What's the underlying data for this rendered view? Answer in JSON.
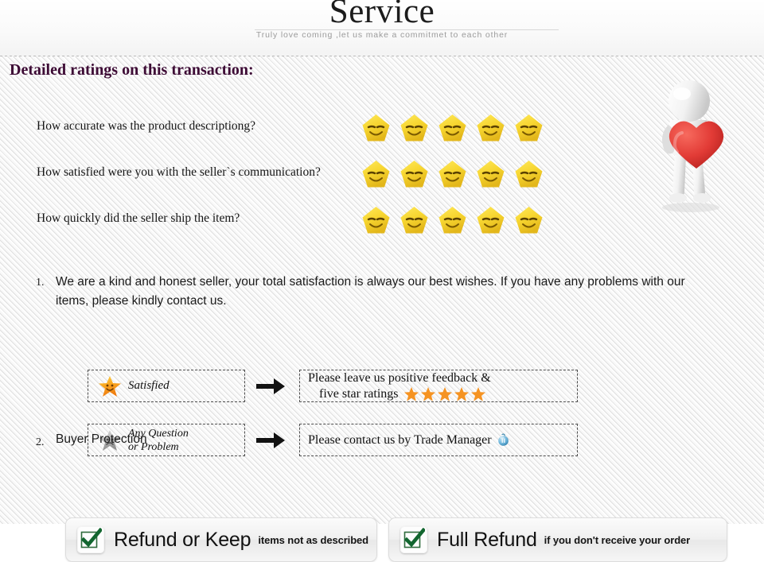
{
  "header": {
    "title": "Service",
    "subtitle": "Truly love coming ,let us make a commitmet to each other"
  },
  "section": {
    "heading": "Detailed ratings on this transaction:",
    "heading_color": "#3d0b35"
  },
  "ratings": {
    "star_count_per_row": 5,
    "star_icon": "gold-smiley-star-icon",
    "rows": [
      {
        "question": "How accurate was the product descriptiong?",
        "stars": 5
      },
      {
        "question": "How satisfied were you with the seller`s communication?",
        "stars": 5
      },
      {
        "question": "How quickly did the seller ship the item?",
        "stars": 5
      }
    ]
  },
  "hero": {
    "icon": "3d-figure-holding-heart-illustration",
    "heart_color": "#e23b36",
    "figure_color": "#e9e9e9"
  },
  "items": [
    {
      "number": "1.",
      "text": "We are a kind and honest seller, your total satisfaction is always our best wishes. If you have any problems with our items, please kindly contact us."
    },
    {
      "number": "2.",
      "text": "Buyer Protection"
    }
  ],
  "flow": {
    "arrow_icon": "right-arrow-icon",
    "rows": [
      {
        "left": {
          "icon": "orange-happy-star-icon",
          "label": "Satisfied"
        },
        "right": {
          "line1": "Please leave us positive feedback &",
          "line2": "five star ratings",
          "trailing_stars": 5,
          "trailing_star_icon": "orange-star-icon"
        }
      },
      {
        "left": {
          "icon": "gray-sad-star-icon",
          "label_line1": "Any Question",
          "label_line2": "or Problem"
        },
        "right": {
          "line1": "Please contact us by Trade Manager",
          "trailing_icon": "trade-manager-icon",
          "trailing_icon_color": "#4a9fd0"
        }
      }
    ]
  },
  "protection": {
    "plates": [
      {
        "check_icon": "green-checkmark-icon",
        "check_color": "#12662f",
        "title": "Refund or Keep",
        "subtitle": "items not as described"
      },
      {
        "check_icon": "green-checkmark-icon",
        "check_color": "#12662f",
        "title": "Full Refund",
        "subtitle": "if you don't receive your order"
      }
    ]
  }
}
